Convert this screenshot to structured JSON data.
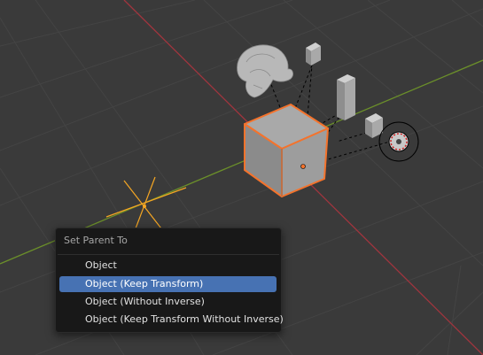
{
  "colors": {
    "background": "#3a3a3a",
    "grid": "#434343",
    "x_axis": "#a1353e",
    "y_axis": "#6b8f2a",
    "selection_outline": "#f4732c",
    "menu_background": "#181818",
    "menu_highlight": "#4772b3"
  },
  "scene": {
    "objects": [
      "monkey-mesh",
      "selected-cube",
      "small-cube-1",
      "tall-box",
      "small-cube-2",
      "light-source",
      "empty-axes"
    ]
  },
  "menu": {
    "title": "Set Parent To",
    "items": [
      {
        "label": "Object",
        "active": false
      },
      {
        "label": "Object (Keep Transform)",
        "active": true
      },
      {
        "label": "Object (Without Inverse)",
        "active": false
      },
      {
        "label": "Object (Keep Transform Without Inverse)",
        "active": false
      }
    ]
  }
}
